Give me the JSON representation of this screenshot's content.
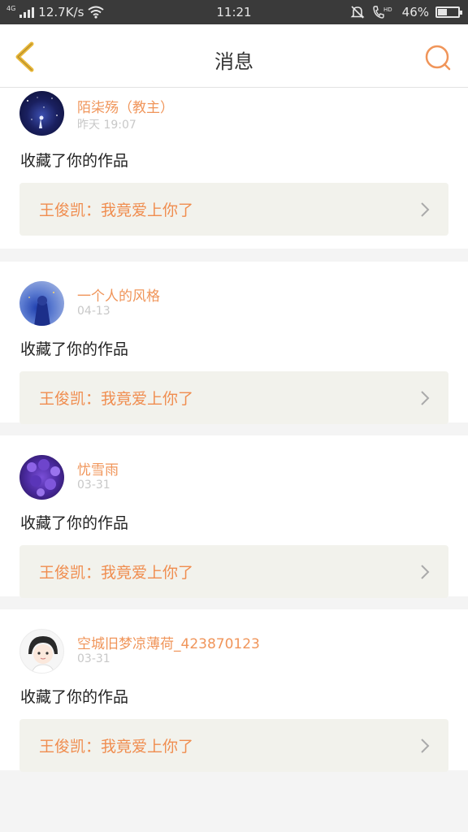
{
  "status_bar": {
    "network_type": "4G",
    "speed": "12.7K/s",
    "time": "11:21",
    "hd_label": "HD",
    "battery": "46%",
    "battery_level": 0.46
  },
  "nav": {
    "title": "消息"
  },
  "colors": {
    "accent": "#f0955a",
    "back_icon": "#e9b83a",
    "card_link_bg": "#f2f2ec"
  },
  "messages": [
    {
      "username": "陌柒殇（教主）",
      "time": "昨天 19:07",
      "action": "收藏了你的作品",
      "work_title": "王俊凯：我竟爱上你了",
      "avatar": "avatar-starry-night"
    },
    {
      "username": "一个人的风格",
      "time": "04-13",
      "action": "收藏了你的作品",
      "work_title": "王俊凯：我竟爱上你了",
      "avatar": "avatar-blue-figure"
    },
    {
      "username": "忧雪雨",
      "time": "03-31",
      "action": "收藏了你的作品",
      "work_title": "王俊凯：我竟爱上你了",
      "avatar": "avatar-purple-flowers"
    },
    {
      "username": "空城旧梦凉薄荷_423870123",
      "time": "03-31",
      "action": "收藏了你的作品",
      "work_title": "王俊凯：我竟爱上你了",
      "avatar": "avatar-cartoon-girl"
    }
  ]
}
